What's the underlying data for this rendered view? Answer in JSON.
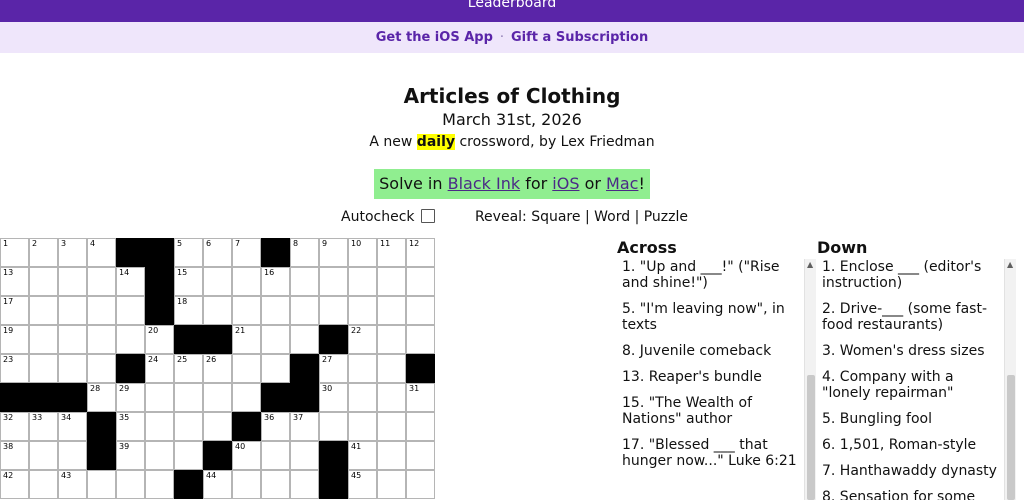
{
  "topbar": {
    "label": "Leaderboard"
  },
  "subbar": {
    "ios_app": "Get the iOS App",
    "separator": "·",
    "gift": "Gift a Subscription"
  },
  "puzzle": {
    "title": "Articles of Clothing",
    "date": "March 31st, 2026",
    "byline_pre": "A new ",
    "byline_highlight": "daily",
    "byline_post": " crossword, by Lex Friedman"
  },
  "solve_banner": {
    "prefix": "Solve in ",
    "black_ink": "Black Ink",
    "for_text": " for ",
    "ios": "iOS",
    "or_text": " or ",
    "mac": "Mac",
    "suffix": "!",
    "bg_color": "#90ee90"
  },
  "controls": {
    "autocheck": "Autocheck",
    "autocheck_checked": false,
    "reveal": "Reveal:",
    "square": "Square",
    "word": "Word",
    "puzzle": "Puzzle",
    "divider": "|"
  },
  "grid": {
    "rows": [
      [
        "1",
        "2",
        "3",
        "4",
        "#",
        "#",
        "5",
        "6",
        "7",
        "#",
        "8",
        "9",
        "10",
        "11",
        "12"
      ],
      [
        "13",
        "",
        "",
        "",
        "14",
        "#",
        "15",
        "",
        "",
        "16",
        "",
        "",
        "",
        "",
        ""
      ],
      [
        "17",
        "",
        "",
        "",
        "",
        "#",
        "18",
        "",
        "",
        "",
        "",
        "",
        "",
        "",
        ""
      ],
      [
        "19",
        "",
        "",
        "",
        "",
        "20",
        "#",
        "#",
        "21",
        "",
        "",
        "#",
        "22",
        "",
        ""
      ],
      [
        "23",
        "",
        "",
        "",
        "#",
        "24",
        "25",
        "26",
        "",
        "",
        "#",
        "27",
        "",
        "",
        "#"
      ],
      [
        "#",
        "#",
        "#",
        "28",
        "29",
        "",
        "",
        "",
        "",
        "#",
        "#",
        "30",
        "",
        "",
        "31"
      ],
      [
        "32",
        "33",
        "34",
        "#",
        "35",
        "",
        "",
        "",
        "#",
        "36",
        "37",
        "",
        "",
        "",
        ""
      ],
      [
        "38",
        "",
        "",
        "#",
        "39",
        "",
        "",
        "#",
        "40",
        "",
        "",
        "#",
        "41",
        "",
        ""
      ],
      [
        "42",
        "",
        "43",
        "",
        "",
        "",
        "#",
        "44",
        "",
        "",
        "",
        "#",
        "45",
        "",
        ""
      ]
    ]
  },
  "across": {
    "heading": "Across",
    "clues": [
      "1. \"Up and ___!\" (\"Rise and shine!\")",
      "5. \"I'm leaving now\", in texts",
      "8. Juvenile comeback",
      "13. Reaper's bundle",
      "15. \"The Wealth of Nations\" author",
      "17. \"Blessed ___ that hunger now...\" Luke 6:21"
    ]
  },
  "down": {
    "heading": "Down",
    "clues": [
      "1. Enclose ___ (editor's instruction)",
      "2. Drive-___ (some fast-food restaurants)",
      "3. Women's dress sizes",
      "4. Company with a \"lonely repairman\"",
      "5. Bungling fool",
      "6. 1,501, Roman-style",
      "7. Hanthawaddy dynasty",
      "8. Sensation for some"
    ]
  },
  "colors": {
    "accent": "#5a25a8",
    "subbar_bg": "#efe6fb",
    "highlight": "#ffff00"
  }
}
